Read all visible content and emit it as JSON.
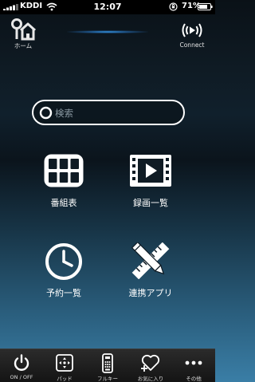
{
  "status_bar": {
    "carrier": "KDDI",
    "time": "12:07",
    "battery": "71%"
  },
  "header": {
    "home_label": "ホーム",
    "connect_label": "Connect"
  },
  "search": {
    "placeholder": "検索"
  },
  "menu": {
    "items": [
      {
        "label": "番組表",
        "icon": "grid-icon"
      },
      {
        "label": "録画一覧",
        "icon": "film-icon"
      },
      {
        "label": "予約一覧",
        "icon": "clock-icon"
      },
      {
        "label": "連携アプリ",
        "icon": "pencil-ruler-icon"
      }
    ]
  },
  "tabbar": {
    "items": [
      {
        "label": "ON / OFF",
        "icon": "power-icon"
      },
      {
        "label": "パッド",
        "icon": "dpad-icon"
      },
      {
        "label": "フルキー",
        "icon": "remote-icon"
      },
      {
        "label": "お気に入り",
        "icon": "heart-plus-icon"
      },
      {
        "label": "その他",
        "icon": "more-icon"
      }
    ]
  },
  "colors": {
    "accent_glow": "#3caaff",
    "tabbar_bg": "#1c1c1c"
  }
}
